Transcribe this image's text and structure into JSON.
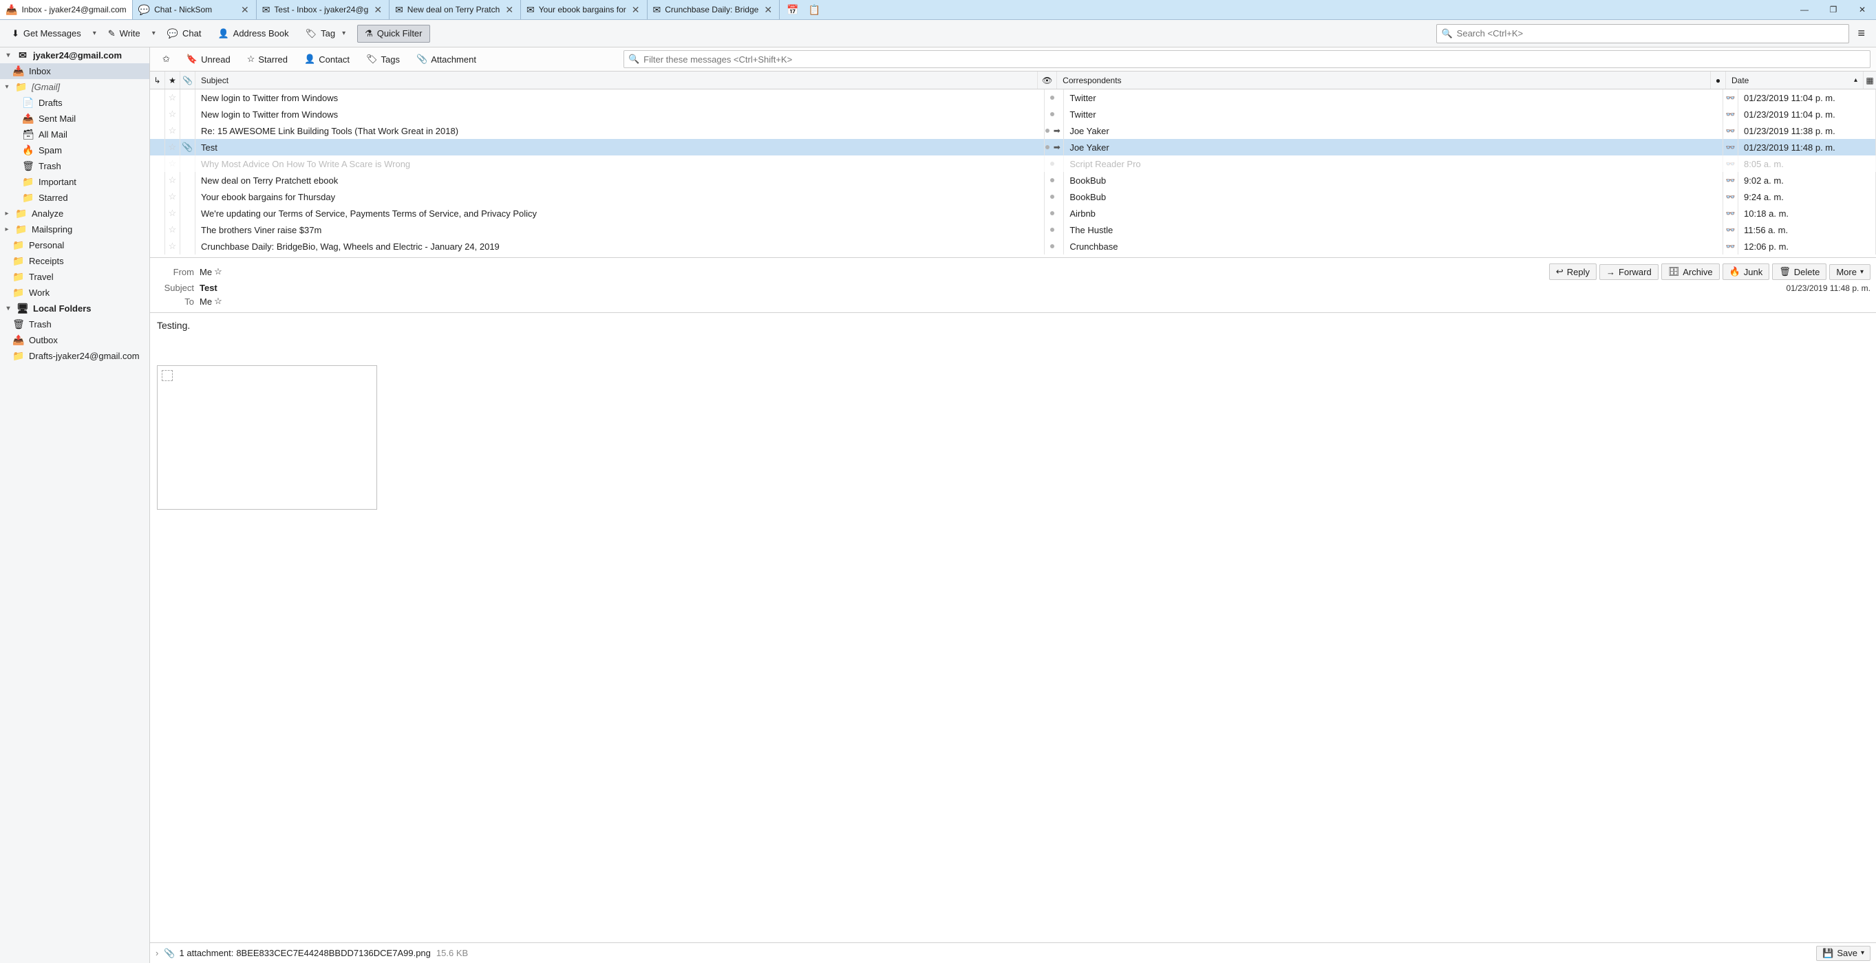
{
  "tabs": [
    {
      "label": "Inbox - jyaker24@gmail.com",
      "closable": false,
      "icon": "inbox"
    },
    {
      "label": "Chat - NickSom",
      "closable": true,
      "icon": "chat"
    },
    {
      "label": "Test - Inbox - jyaker24@g",
      "closable": true,
      "icon": "mail"
    },
    {
      "label": "New deal on Terry Pratch",
      "closable": true,
      "icon": "mail"
    },
    {
      "label": "Your ebook bargains for",
      "closable": true,
      "icon": "mail"
    },
    {
      "label": "Crunchbase Daily: Bridge",
      "closable": true,
      "icon": "mail"
    }
  ],
  "search_placeholder": "Search <Ctrl+K>",
  "toolbar": {
    "get_messages": "Get Messages",
    "write": "Write",
    "chat": "Chat",
    "address_book": "Address Book",
    "tag": "Tag",
    "quick_filter": "Quick Filter"
  },
  "quickfilter": {
    "unread": "Unread",
    "starred": "Starred",
    "contact": "Contact",
    "tags": "Tags",
    "attachment": "Attachment",
    "filter_placeholder": "Filter these messages <Ctrl+Shift+K>"
  },
  "folders": {
    "account": "jyaker24@gmail.com",
    "inbox": "Inbox",
    "gmail": "[Gmail]",
    "drafts": "Drafts",
    "sent": "Sent Mail",
    "all": "All Mail",
    "spam": "Spam",
    "trash": "Trash",
    "important": "Important",
    "starred": "Starred",
    "analyze": "Analyze",
    "mailspring": "Mailspring",
    "personal": "Personal",
    "receipts": "Receipts",
    "travel": "Travel",
    "work": "Work",
    "local": "Local Folders",
    "ltrash": "Trash",
    "outbox": "Outbox",
    "ldrafts": "Drafts-jyaker24@gmail.com"
  },
  "columns": {
    "subject": "Subject",
    "correspondents": "Correspondents",
    "date": "Date"
  },
  "messages": [
    {
      "subject": "New login to Twitter from Windows",
      "from": "Twitter",
      "date": "01/23/2019 11:04 p. m.",
      "outgoing": false
    },
    {
      "subject": "New login to Twitter from Windows",
      "from": "Twitter",
      "date": "01/23/2019 11:04 p. m.",
      "outgoing": false
    },
    {
      "subject": "Re: 15 AWESOME Link Building Tools (That Work Great in 2018)",
      "from": "Joe Yaker",
      "date": "01/23/2019 11:38 p. m.",
      "outgoing": true
    },
    {
      "subject": "Test",
      "from": "Joe Yaker",
      "date": "01/23/2019 11:48 p. m.",
      "outgoing": true,
      "selected": true,
      "attachment": true
    },
    {
      "subject": "Why Most Advice On How To Write A Scare is Wrong",
      "from": "Script Reader Pro",
      "date": "8:05 a. m.",
      "outgoing": false,
      "dim": true
    },
    {
      "subject": "New deal on Terry Pratchett ebook",
      "from": "BookBub",
      "date": "9:02 a. m.",
      "outgoing": false
    },
    {
      "subject": "Your ebook bargains for Thursday",
      "from": "BookBub",
      "date": "9:24 a. m.",
      "outgoing": false
    },
    {
      "subject": "We're updating our Terms of Service, Payments Terms of Service, and Privacy Policy",
      "from": "Airbnb",
      "date": "10:18 a. m.",
      "outgoing": false
    },
    {
      "subject": "The brothers Viner raise $37m",
      "from": "The Hustle",
      "date": "11:56 a. m.",
      "outgoing": false
    },
    {
      "subject": "Crunchbase Daily: BridgeBio, Wag, Wheels and Electric - January 24, 2019",
      "from": "Crunchbase",
      "date": "12:06 p. m.",
      "outgoing": false
    }
  ],
  "preview": {
    "from_label": "From",
    "from_value": "Me",
    "subject_label": "Subject",
    "subject_value": "Test",
    "to_label": "To",
    "to_value": "Me",
    "date": "01/23/2019 11:48 p. m.",
    "body_text": "Testing.",
    "reply": "Reply",
    "forward": "Forward",
    "archive": "Archive",
    "junk": "Junk",
    "delete": "Delete",
    "more": "More"
  },
  "attachment": {
    "label": "1 attachment:",
    "name": "8BEE833CEC7E44248BBDD7136DCE7A99.png",
    "size": "15.6 KB",
    "save": "Save"
  }
}
